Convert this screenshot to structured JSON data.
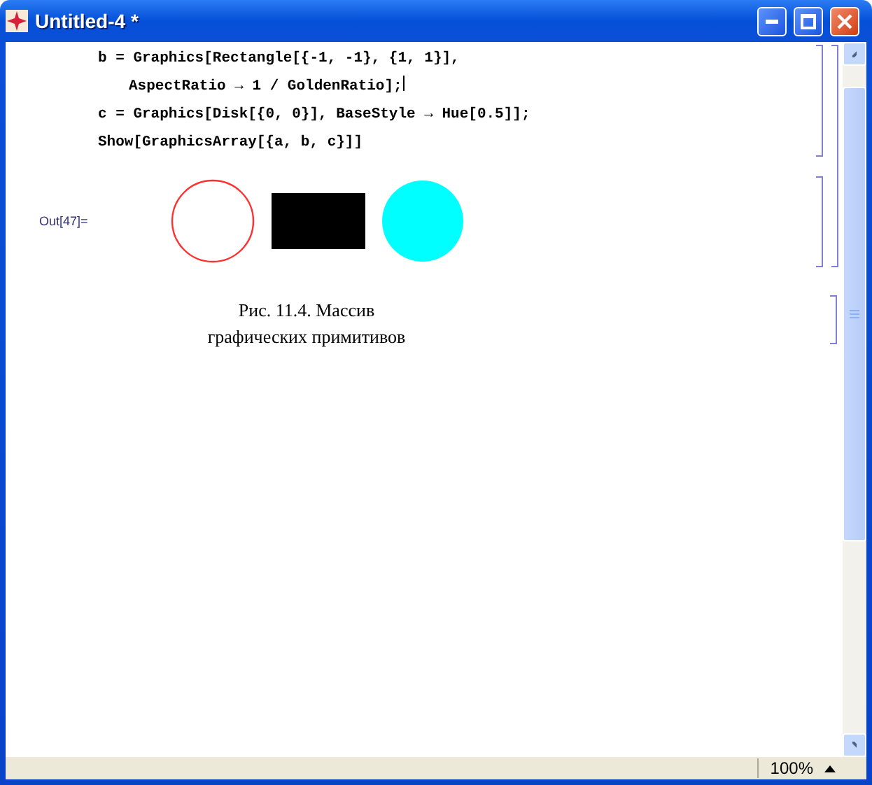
{
  "window": {
    "title": "Untitled-4 *"
  },
  "input_cell": {
    "lines": [
      {
        "text": "b = Graphics[Rectangle[{-1, -1}, {1, 1}],",
        "continued": false,
        "cursor": false
      },
      {
        "text": "AspectRatio → 1 / GoldenRatio];",
        "continued": true,
        "cursor": true
      },
      {
        "text": "c = Graphics[Disk[{0, 0}], BaseStyle → Hue[0.5]];",
        "continued": false,
        "cursor": false
      },
      {
        "text": "Show[GraphicsArray[{a, b, c}]]",
        "continued": false,
        "cursor": false
      }
    ]
  },
  "output_cell": {
    "label": "Out[47]=",
    "graphics": [
      {
        "kind": "circle",
        "color": "#ff3030"
      },
      {
        "kind": "rectangle",
        "color": "#000000"
      },
      {
        "kind": "disk",
        "color": "#00ffff"
      }
    ]
  },
  "caption": {
    "lines": [
      "Рис. 11.4. Массив",
      "графических примитивов"
    ]
  },
  "status_bar": {
    "zoom": "100%"
  }
}
